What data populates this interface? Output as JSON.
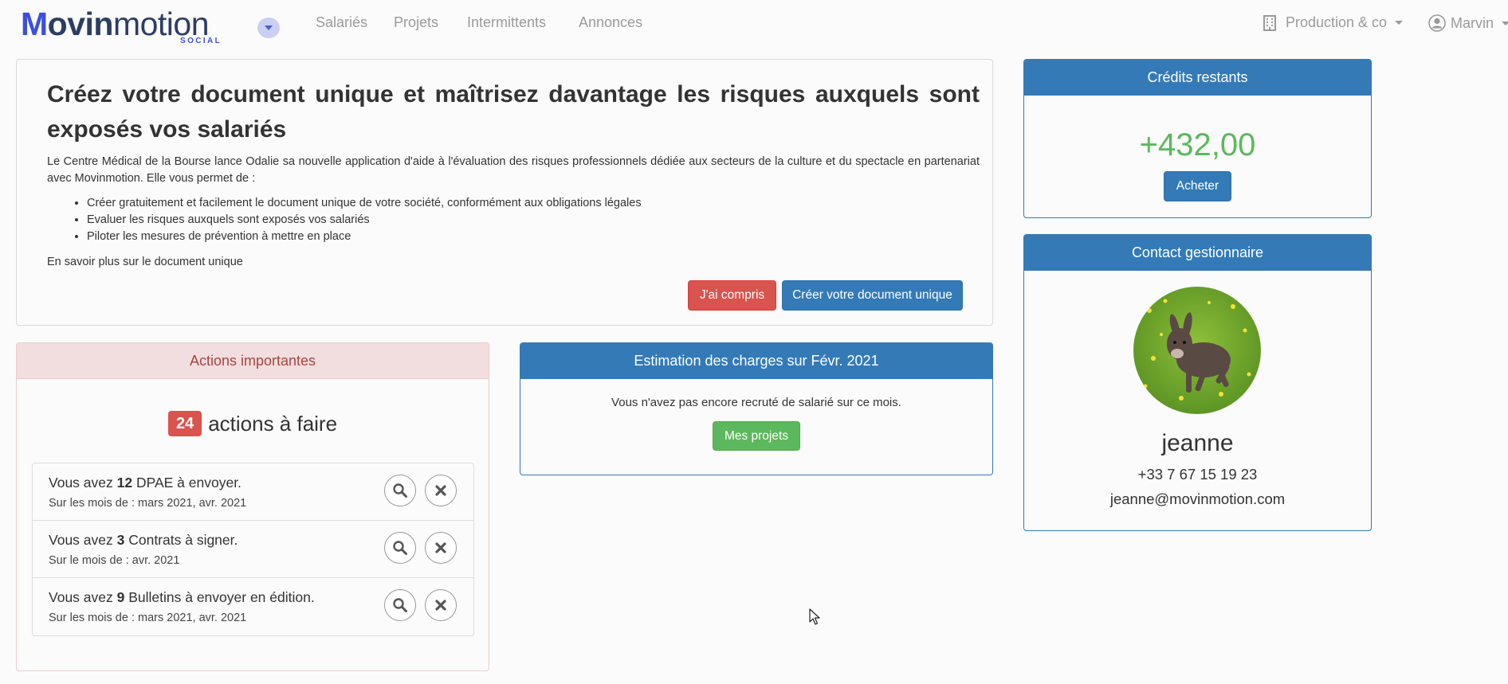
{
  "brand": {
    "name_strong": "ovin",
    "name_m": "M",
    "name_light": "motion",
    "sub": "SOCIAL",
    "accent": "#3c4fdc"
  },
  "nav": {
    "toggle_icon": "chevron-down-icon",
    "links": [
      "Salariés",
      "Projets",
      "Intermittents",
      "Annonces"
    ],
    "company": "Production & co",
    "user": "Marvin"
  },
  "due": {
    "title": "Créez votre document unique et maîtrisez davantage les risques auxquels sont exposés vos salariés",
    "intro": "Le Centre Médical de la Bourse lance Odalie sa nouvelle application d'aide à l'évaluation des risques professionnels dédiée aux secteurs de la culture et du spectacle en partenariat avec Movinmotion. Elle vous permet de :",
    "items": [
      "Créer gratuitement et facilement le document unique de votre société, conformément aux obligations légales",
      "Evaluer les risques auxquels sont exposés vos salariés",
      "Piloter les mesures de prévention à mettre en place"
    ],
    "more_link": "En savoir plus sur le document unique",
    "dismiss_label": "J'ai compris",
    "create_label": "Créer votre document unique"
  },
  "credits": {
    "title": "Crédits restants",
    "value": "+432,00",
    "buy_label": "Acheter",
    "value_color": "#5cb85c"
  },
  "contact": {
    "title": "Contact gestionnaire",
    "name": "jeanne",
    "phone": "+33 7 67 15 19 23",
    "email": "jeanne@movinmotion.com"
  },
  "actions": {
    "title": "Actions importantes",
    "count": "24",
    "count_label": "actions à faire",
    "items": [
      {
        "prefix": "Vous avez ",
        "number": "12",
        "suffix": " DPAE à envoyer.",
        "sub": "Sur les mois de : mars 2021, avr. 2021"
      },
      {
        "prefix": "Vous avez ",
        "number": "3",
        "suffix": " Contrats à signer.",
        "sub": "Sur le mois de : avr. 2021"
      },
      {
        "prefix": "Vous avez ",
        "number": "9",
        "suffix": " Bulletins à envoyer en édition.",
        "sub": "Sur les mois de : mars 2021, avr. 2021"
      }
    ]
  },
  "estimation": {
    "title": "Estimation des charges sur Févr. 2021",
    "text": "Vous n'avez pas encore recruté de salarié sur ce mois.",
    "projects_label": "Mes projets"
  }
}
